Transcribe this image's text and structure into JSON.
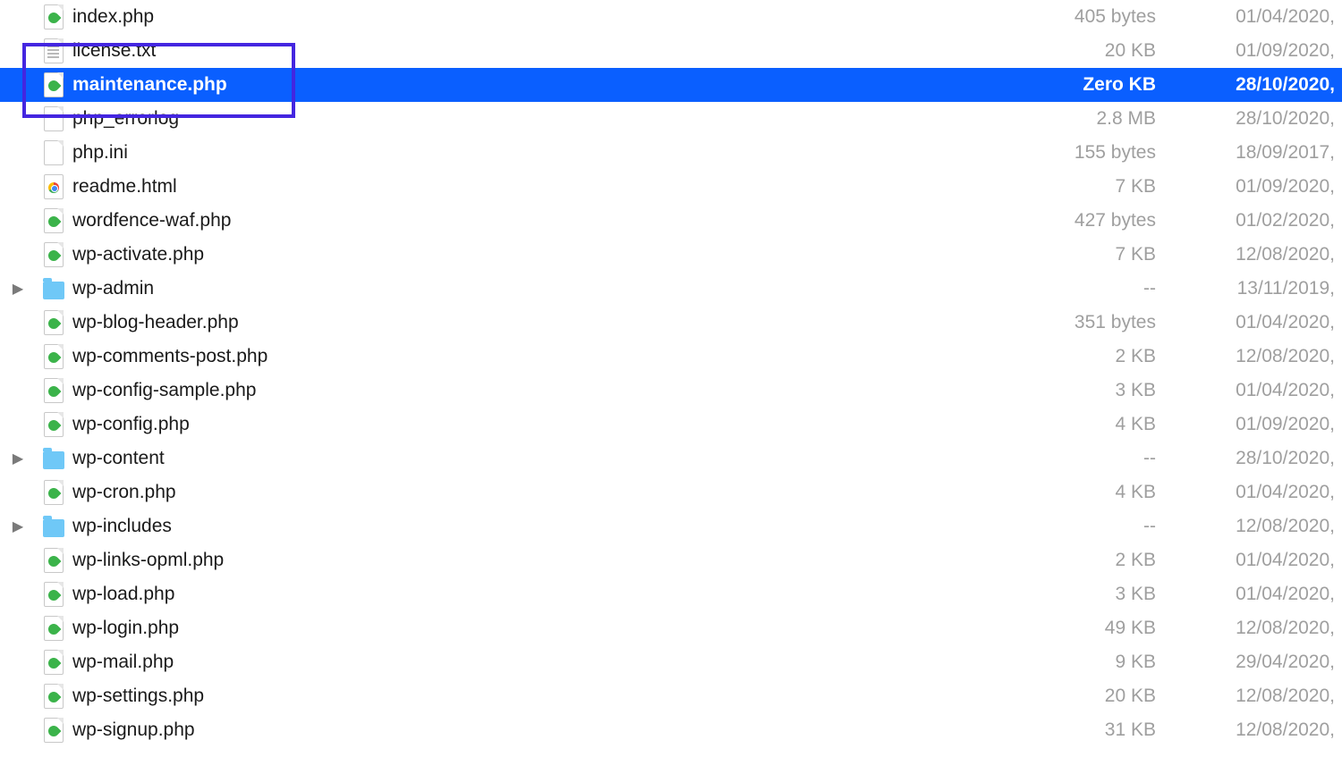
{
  "highlight": {
    "target_index": 2
  },
  "files": [
    {
      "name": "index.php",
      "size": "405 bytes",
      "date": "01/04/2020,",
      "selected": false,
      "kind": "php",
      "expandable": false
    },
    {
      "name": "license.txt",
      "size": "20 KB",
      "date": "01/09/2020,",
      "selected": false,
      "kind": "txt",
      "expandable": false
    },
    {
      "name": "maintenance.php",
      "size": "Zero KB",
      "date": "28/10/2020,",
      "selected": true,
      "kind": "php",
      "expandable": false
    },
    {
      "name": "php_errorlog",
      "size": "2.8 MB",
      "date": "28/10/2020,",
      "selected": false,
      "kind": "blank",
      "expandable": false
    },
    {
      "name": "php.ini",
      "size": "155 bytes",
      "date": "18/09/2017,",
      "selected": false,
      "kind": "blank",
      "expandable": false
    },
    {
      "name": "readme.html",
      "size": "7 KB",
      "date": "01/09/2020,",
      "selected": false,
      "kind": "chrome",
      "expandable": false
    },
    {
      "name": "wordfence-waf.php",
      "size": "427 bytes",
      "date": "01/02/2020,",
      "selected": false,
      "kind": "php",
      "expandable": false
    },
    {
      "name": "wp-activate.php",
      "size": "7 KB",
      "date": "12/08/2020,",
      "selected": false,
      "kind": "php",
      "expandable": false
    },
    {
      "name": "wp-admin",
      "size": "--",
      "date": "13/11/2019,",
      "selected": false,
      "kind": "folder",
      "expandable": true
    },
    {
      "name": "wp-blog-header.php",
      "size": "351 bytes",
      "date": "01/04/2020,",
      "selected": false,
      "kind": "php",
      "expandable": false
    },
    {
      "name": "wp-comments-post.php",
      "size": "2 KB",
      "date": "12/08/2020,",
      "selected": false,
      "kind": "php",
      "expandable": false
    },
    {
      "name": "wp-config-sample.php",
      "size": "3 KB",
      "date": "01/04/2020,",
      "selected": false,
      "kind": "php",
      "expandable": false
    },
    {
      "name": "wp-config.php",
      "size": "4 KB",
      "date": "01/09/2020,",
      "selected": false,
      "kind": "php",
      "expandable": false
    },
    {
      "name": "wp-content",
      "size": "--",
      "date": "28/10/2020,",
      "selected": false,
      "kind": "folder",
      "expandable": true
    },
    {
      "name": "wp-cron.php",
      "size": "4 KB",
      "date": "01/04/2020,",
      "selected": false,
      "kind": "php",
      "expandable": false
    },
    {
      "name": "wp-includes",
      "size": "--",
      "date": "12/08/2020,",
      "selected": false,
      "kind": "folder",
      "expandable": true
    },
    {
      "name": "wp-links-opml.php",
      "size": "2 KB",
      "date": "01/04/2020,",
      "selected": false,
      "kind": "php",
      "expandable": false
    },
    {
      "name": "wp-load.php",
      "size": "3 KB",
      "date": "01/04/2020,",
      "selected": false,
      "kind": "php",
      "expandable": false
    },
    {
      "name": "wp-login.php",
      "size": "49 KB",
      "date": "12/08/2020,",
      "selected": false,
      "kind": "php",
      "expandable": false
    },
    {
      "name": "wp-mail.php",
      "size": "9 KB",
      "date": "29/04/2020,",
      "selected": false,
      "kind": "php",
      "expandable": false
    },
    {
      "name": "wp-settings.php",
      "size": "20 KB",
      "date": "12/08/2020,",
      "selected": false,
      "kind": "php",
      "expandable": false
    },
    {
      "name": "wp-signup.php",
      "size": "31 KB",
      "date": "12/08/2020,",
      "selected": false,
      "kind": "php",
      "expandable": false
    }
  ]
}
